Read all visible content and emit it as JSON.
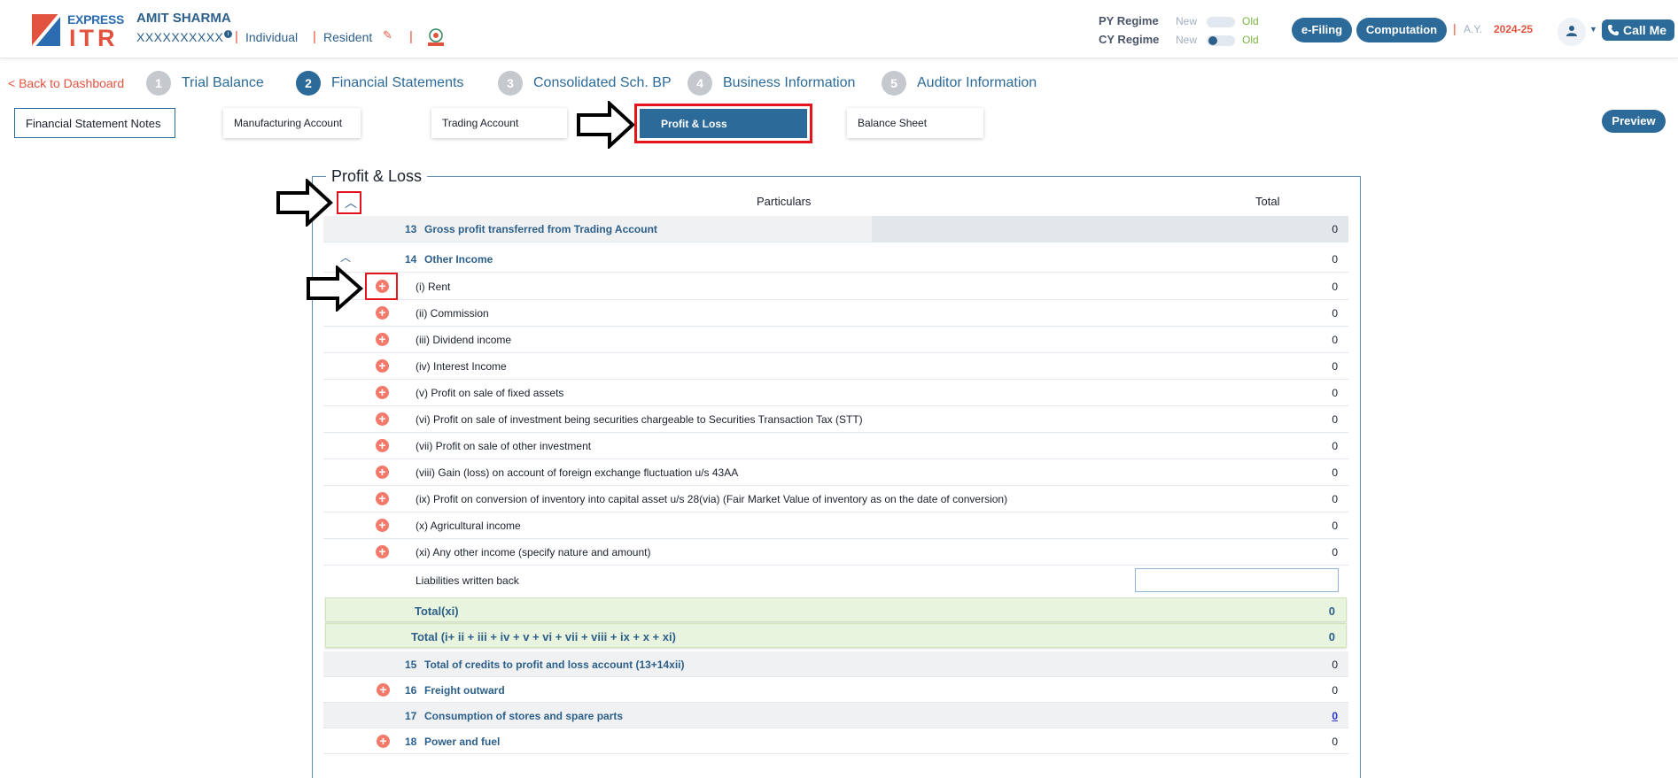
{
  "header": {
    "logo_top": "EXPRESS",
    "logo_bottom": "ITR",
    "user_name": "AMIT SHARMA",
    "pan": "XXXXXXXXXX",
    "user_type": "Individual",
    "residency": "Resident",
    "py_regime_label": "PY Regime",
    "cy_regime_label": "CY Regime",
    "regime_new": "New",
    "regime_old": "Old",
    "efiling_label": "e-Filing",
    "computation_label": "Computation",
    "ay_label": "A.Y.",
    "ay_value": "2024-25",
    "call_me_label": "Call Me"
  },
  "stepper": {
    "back_label": "< Back to Dashboard",
    "steps": [
      {
        "num": "1",
        "label": "Trial Balance"
      },
      {
        "num": "2",
        "label": "Financial Statements"
      },
      {
        "num": "3",
        "label": "Consolidated Sch. BP"
      },
      {
        "num": "4",
        "label": "Business Information"
      },
      {
        "num": "5",
        "label": "Auditor Information"
      }
    ]
  },
  "subtabs": {
    "notes": "Financial Statement Notes",
    "manufacturing": "Manufacturing Account",
    "trading": "Trading Account",
    "pl": "Profit & Loss",
    "balance": "Balance Sheet",
    "preview": "Preview"
  },
  "panel": {
    "title": "Profit & Loss",
    "col_particulars": "Particulars",
    "col_total": "Total"
  },
  "rows": {
    "r13": {
      "num": "13",
      "label": "Gross profit transferred from Trading Account",
      "value": "0"
    },
    "r14": {
      "num": "14",
      "label": "Other Income",
      "value": "0"
    },
    "sub": [
      {
        "label": "(i) Rent",
        "value": "0"
      },
      {
        "label": "(ii) Commission",
        "value": "0"
      },
      {
        "label": "(iii) Dividend income",
        "value": "0"
      },
      {
        "label": "(iv) Interest Income",
        "value": "0"
      },
      {
        "label": "(v) Profit on sale of fixed assets",
        "value": "0"
      },
      {
        "label": "(vi) Profit on sale of investment being securities chargeable to Securities Transaction Tax (STT)",
        "value": "0"
      },
      {
        "label": "(vii) Profit on sale of other investment",
        "value": "0"
      },
      {
        "label": "(viii) Gain (loss) on account of foreign exchange fluctuation u/s 43AA",
        "value": "0"
      },
      {
        "label": "(ix) Profit on conversion of inventory into capital asset u/s 28(via) (Fair Market Value of inventory as on the date of conversion)",
        "value": "0"
      },
      {
        "label": "(x) Agricultural income",
        "value": "0"
      },
      {
        "label": "(xi) Any other income (specify nature and amount)",
        "value": "0"
      }
    ],
    "liabilities": {
      "label": "Liabilities written back",
      "value": ""
    },
    "total_xi": {
      "label": "Total(xi)",
      "value": "0"
    },
    "total_xii": {
      "label": "Total (i+ ii + iii + iv + v + vi + vii + viii + ix + x + xi)",
      "value": "0"
    },
    "r15": {
      "num": "15",
      "label": "Total of credits to profit and loss account (13+14xii)",
      "value": "0"
    },
    "r16": {
      "num": "16",
      "label": "Freight outward",
      "value": "0"
    },
    "r17": {
      "num": "17",
      "label": "Consumption of stores and spare parts",
      "value": "0"
    },
    "r18": {
      "num": "18",
      "label": "Power and fuel",
      "value": "0"
    }
  },
  "colors": {
    "primary": "#2c6a99",
    "accent": "#e2533f",
    "highlight": "#e3141c",
    "total_bg": "#e8f4dd"
  }
}
